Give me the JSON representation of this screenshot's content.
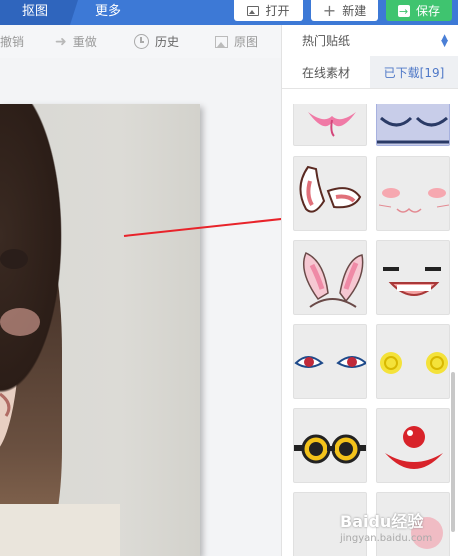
{
  "tabs": {
    "active_label": "抠图",
    "more_label": "更多"
  },
  "actions": {
    "open_label": "打开",
    "new_label": "新建",
    "save_label": "保存"
  },
  "toolbar": {
    "undo_label": "撤销",
    "redo_label": "重做",
    "history_label": "历史",
    "original_label": "原图"
  },
  "sidebar": {
    "category_label": "热门贴纸",
    "online_tab_label": "在线素材",
    "downloaded_tab_label": "已下载[19]",
    "stickers": [
      "pink-bow-sticker",
      "blue-glasses-sticker",
      "bunny-ears-outline-sticker",
      "blush-whiskers-sticker",
      "pink-bunny-ears-sticker",
      "laughing-mouth-sticker",
      "blue-eyes-sticker",
      "yellow-swirl-eyes-sticker",
      "goggles-sticker",
      "clown-nose-mouth-sticker",
      "partial-sticker-1",
      "partial-sticker-2"
    ]
  },
  "watermark": {
    "text": "Baidu经验",
    "subtext": "jingyan.baidu.com"
  },
  "colors": {
    "topbar": "#3d79d6",
    "save_button": "#3fc46f",
    "arrow": "#e8232a",
    "selected_cell": "#c8cde9"
  }
}
